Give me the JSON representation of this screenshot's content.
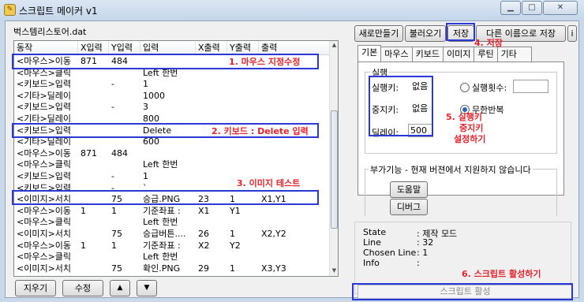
{
  "window": {
    "title": "스크립트 메이커 v1"
  },
  "file_name": "벅스템리스토어.dat",
  "table": {
    "headers": [
      "동작",
      "X입력",
      "Y입력",
      "입력",
      "X출력",
      "Y출력",
      "출력"
    ],
    "rows": [
      [
        "<마우스>이동",
        "871",
        "484",
        "",
        "",
        "",
        ""
      ],
      [
        "<마우스>클릭",
        "",
        "",
        "Left 한번",
        "",
        "",
        ""
      ],
      [
        "<키보드>입력",
        "",
        "-",
        "1",
        "",
        "",
        ""
      ],
      [
        "<기타>딜레이",
        "",
        "",
        "1000",
        "",
        "",
        ""
      ],
      [
        "<키보드>입력",
        "",
        "-",
        "3",
        "",
        "",
        ""
      ],
      [
        "<기타>딜레이",
        "",
        "",
        "800",
        "",
        "",
        ""
      ],
      [
        "<키보드>입력",
        "",
        "",
        "Delete",
        "",
        "",
        ""
      ],
      [
        "<기타>딜레이",
        "",
        "",
        "600",
        "",
        "",
        ""
      ],
      [
        "<마우스>이동",
        "871",
        "484",
        "",
        "",
        "",
        ""
      ],
      [
        "<마우스>클릭",
        "",
        "",
        "Left 한번",
        "",
        "",
        ""
      ],
      [
        "<키보드>입력",
        "",
        "-",
        "1",
        "",
        "",
        ""
      ],
      [
        "<키보드>입력",
        "",
        "-",
        "`",
        "",
        "",
        ""
      ],
      [
        "<이미지>서치",
        "",
        "75",
        "승급.PNG",
        "23",
        "1",
        "X1,Y1"
      ],
      [
        "<마우스>이동",
        "1",
        "1",
        "기준좌표 :",
        "X1",
        "Y1",
        ""
      ],
      [
        "<마우스>클릭",
        "",
        "",
        "Left 한번",
        "",
        "",
        ""
      ],
      [
        "<이미지>서치",
        "",
        "75",
        "승급버튼....",
        "26",
        "1",
        "X2,Y2"
      ],
      [
        "<마우스>이동",
        "1",
        "1",
        "기준좌표 :",
        "X2",
        "Y2",
        ""
      ],
      [
        "<마우스>클릭",
        "",
        "",
        "Left 한번",
        "",
        "",
        ""
      ],
      [
        "<이미지>서치",
        "",
        "75",
        "확인.PNG",
        "29",
        "1",
        "X3,Y3"
      ]
    ]
  },
  "bottom_buttons": {
    "delete": "지우기",
    "edit": "수정",
    "up": "▲",
    "down": "▼"
  },
  "top_buttons": {
    "new": "새로만들기",
    "load": "불러오기",
    "save": "저장",
    "save_as": "다른 이름으로 저장",
    "info": "i"
  },
  "tabs": [
    "기본",
    "마우스",
    "키보드",
    "이미지",
    "루틴",
    "기타"
  ],
  "run_group": {
    "label": "실행",
    "run_key_label": "실행키:",
    "run_key_value": "없음",
    "stop_key_label": "중지키:",
    "stop_key_value": "없음",
    "delay_label": "딜레이:",
    "delay_value": "500",
    "run_count_label": "실행횟수:",
    "infinite_label": "무한반복"
  },
  "extra_group": {
    "label": "부가기능 - 현재 버젼에서 지원하지 않습니다",
    "help_button": "도움말",
    "debug_button": "디버그"
  },
  "info": {
    "state_key": "State",
    "state_value": ": 제작 모드",
    "line_key": "Line",
    "line_value": ": 32",
    "chosen_key": "Chosen Line",
    "chosen_value": ": 1",
    "info_key": "Info",
    "info_value": ":"
  },
  "activate_button": "스크립트 활성",
  "annotations": {
    "a1": "1. 마우스 지정수정",
    "a2": "2. 키보드 : Delete 입력",
    "a3": "3. 이미지 테스트",
    "a4": "4. 저장",
    "a5_1": "5. 실행키",
    "a5_2": "중지키",
    "a5_3": "설정하기",
    "a6": "6. 스크립트 활성하기"
  },
  "colors": {
    "annotation_red": "#e8232b",
    "highlight_blue": "#2a38d8"
  }
}
